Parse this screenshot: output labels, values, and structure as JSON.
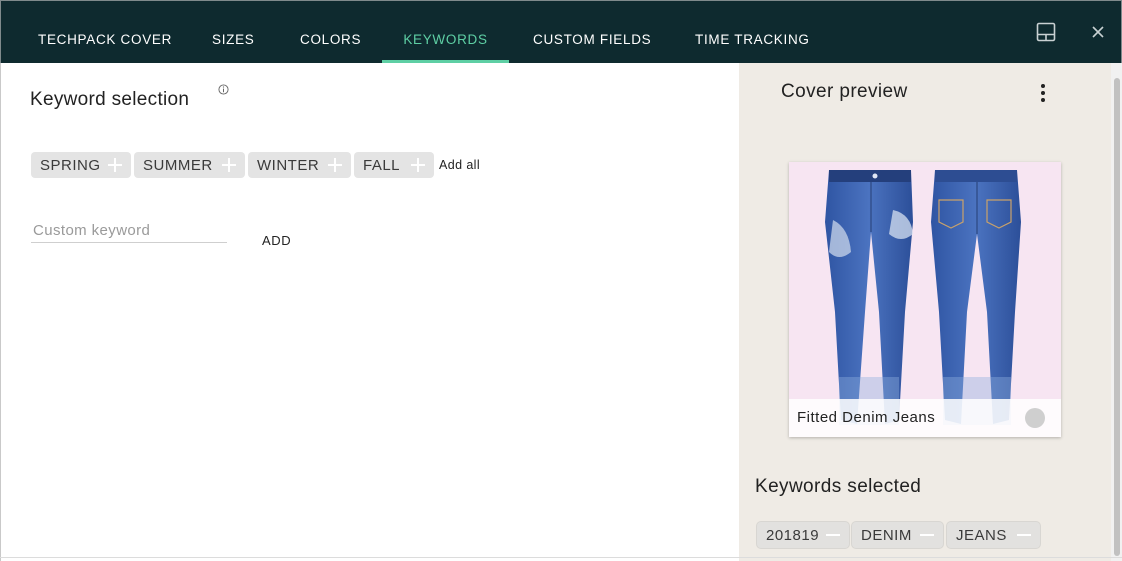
{
  "tabs": [
    {
      "label": "TECHPACK COVER"
    },
    {
      "label": "SIZES"
    },
    {
      "label": "COLORS"
    },
    {
      "label": "KEYWORDS",
      "active": true
    },
    {
      "label": "CUSTOM FIELDS"
    },
    {
      "label": "TIME TRACKING"
    }
  ],
  "header_icons": {
    "layout": "panel-layout-icon",
    "close": "close-icon"
  },
  "keyword_selection": {
    "title": "Keyword selection",
    "info_icon": "info-icon",
    "suggestions": [
      "SPRING",
      "SUMMER",
      "WINTER",
      "FALL"
    ],
    "add_all_label": "Add all",
    "custom_input": {
      "placeholder": "Custom keyword",
      "value": ""
    },
    "add_label": "ADD"
  },
  "cover_preview": {
    "title": "Cover preview",
    "menu_icon": "more-vertical-icon",
    "product_name": "Fitted Denim Jeans"
  },
  "keywords_selected": {
    "title": "Keywords selected",
    "items": [
      "201819",
      "DENIM",
      "JEANS"
    ]
  },
  "colors": {
    "topbar": "#0e2a2f",
    "accent": "#5ecfa4",
    "side_panel": "#efebe5",
    "chip": "#e4e4e4",
    "denim": "#3d64b0"
  }
}
